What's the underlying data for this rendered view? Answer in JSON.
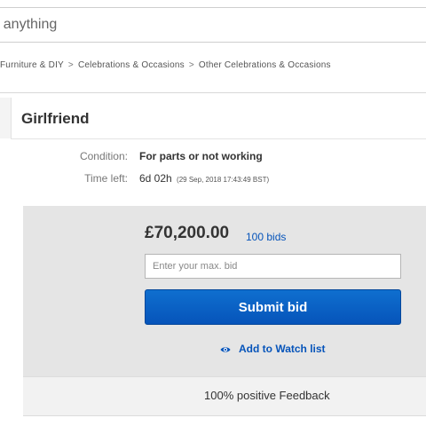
{
  "search": {
    "placeholder": "r anything"
  },
  "breadcrumb": {
    "items": [
      "Furniture & DIY",
      "Celebrations & Occasions",
      "Other Celebrations & Occasions"
    ],
    "separator": ">"
  },
  "item": {
    "title": "Girlfriend",
    "condition_label": "Condition:",
    "condition_value": "For parts or not working",
    "time_left_label": "Time left:",
    "time_left_value": "6d 02h",
    "time_left_detail": "(29 Sep, 2018   17:43:49 BST)"
  },
  "bid": {
    "price": "£70,200.00",
    "bids_count": "100 bids",
    "max_bid_placeholder": "Enter your max. bid",
    "submit_label": "Submit bid",
    "watch_label": "Add to Watch list",
    "feedback": "100% positive Feedback"
  },
  "colors": {
    "link_blue": "#0654ba",
    "button_blue": "#0654ba",
    "panel_gray": "#e5e5e5"
  },
  "icons": {
    "watch": "eye-icon"
  }
}
